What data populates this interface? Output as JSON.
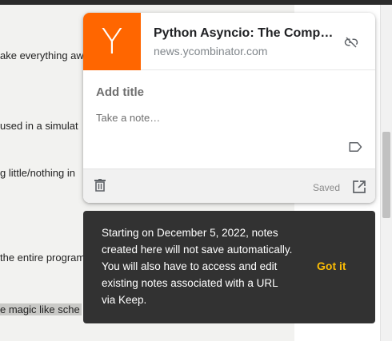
{
  "background_page": {
    "lines": [
      "ake everything aw",
      "used in a simulat",
      "g little/nothing in",
      "the entire program",
      "e magic like sche"
    ]
  },
  "note": {
    "source_logo_letter": "Y",
    "source_logo_color": "#ff6600",
    "title": "Python Asyncio: The Complete Guide",
    "domain": "news.ycombinator.com",
    "title_placeholder": "Add title",
    "note_placeholder": "Take a note…",
    "status": "Saved",
    "icons": {
      "unlink": "link-off-icon",
      "label": "label-icon",
      "trash": "trash-icon",
      "open": "open-in-new-icon"
    }
  },
  "toast": {
    "message": "Starting on December 5, 2022, notes created here will not save automatically. You will also have to access and edit existing notes associated with a URL via Keep.",
    "action": "Got it",
    "action_color": "#fbbc04"
  }
}
